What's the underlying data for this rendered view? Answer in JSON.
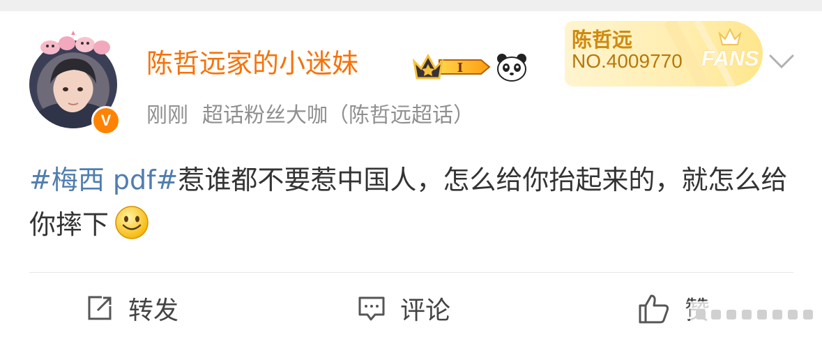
{
  "post": {
    "username": "陈哲远家的小迷妹",
    "time": "刚刚",
    "source": "超话粉丝大咖（陈哲远超话）",
    "topic": "#梅西 pdf#",
    "text": "惹谁都不要惹中国人，怎么给你抬起来的，就怎么给你摔下"
  },
  "badges": {
    "level_label": "I",
    "fans_name": "陈哲远",
    "fans_number": "NO.4009770",
    "fans_word": "FANS"
  },
  "actions": {
    "repost": "转发",
    "comment": "评论",
    "like": "赞"
  },
  "icons": {
    "verified": "V",
    "verified_name": "verified-badge-icon",
    "crown": "crown-icon",
    "panda": "panda-icon",
    "smile": "smile-emoji-icon",
    "repost": "repost-icon",
    "comment": "comment-icon",
    "like": "thumbs-up-icon",
    "more": "chevron-down-icon"
  },
  "colors": {
    "username": "#f6730a",
    "topic": "#507daf",
    "meta": "#8f8f8f",
    "verified": "#ff8200",
    "fans_badge": "#ffeeb0"
  }
}
